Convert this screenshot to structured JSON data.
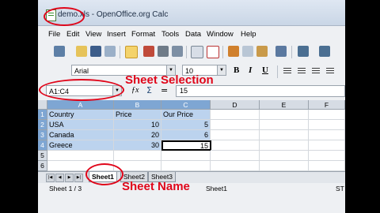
{
  "window": {
    "title": "demo.xls - OpenOffice.org Calc"
  },
  "menu": [
    "File",
    "Edit",
    "View",
    "Insert",
    "Format",
    "Tools",
    "Data",
    "Window",
    "Help"
  ],
  "format": {
    "font_name": "Arial",
    "font_size": "10",
    "bold": "B",
    "italic": "I",
    "underline": "U"
  },
  "formula_bar": {
    "name_box": "A1:C4",
    "fx": "ƒx",
    "sigma": "Σ",
    "equals": "=",
    "content": "15"
  },
  "columns": [
    "A",
    "B",
    "C",
    "D",
    "E",
    "F"
  ],
  "rows": [
    "1",
    "2",
    "3",
    "4",
    "5",
    "6"
  ],
  "cells": {
    "a1": "Country",
    "b1": "Price",
    "c1": "Our Price",
    "a2": "USA",
    "b2": "10",
    "c2": "5",
    "a3": "Canada",
    "b3": "20",
    "c3": "6",
    "a4": "Greece",
    "b4": "30",
    "c4": "15"
  },
  "sheet_tabs": [
    "Sheet1",
    "Sheet2",
    "Sheet3"
  ],
  "status": {
    "page": "Sheet 1 / 3",
    "sheet_name": "Sheet1",
    "std": "ST"
  },
  "annotations": {
    "sheet_selection": "Sheet Selection",
    "sheet_name": "Sheet Name"
  },
  "colors": {
    "annotation": "#e0061a",
    "selection": "#bcd3ee",
    "selected_header": "#7ea6d3"
  }
}
